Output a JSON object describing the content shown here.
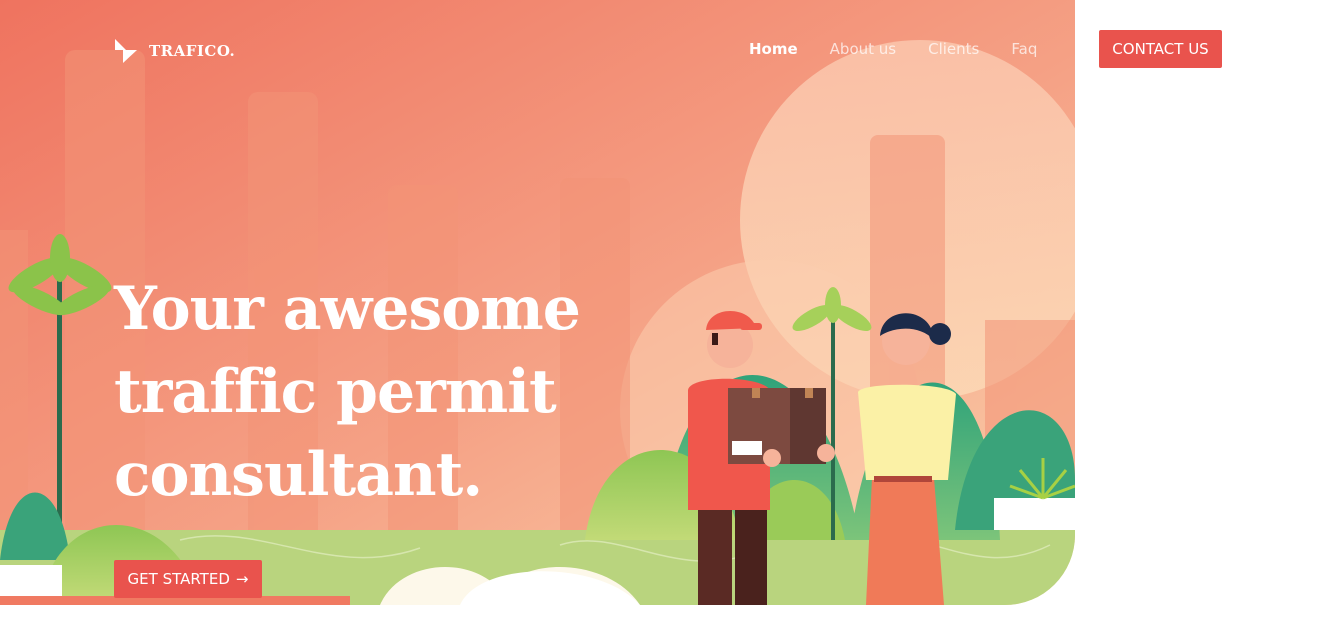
{
  "brand": {
    "name": "TRAFICO."
  },
  "nav": {
    "items": [
      {
        "label": "Home",
        "active": true
      },
      {
        "label": "About us"
      },
      {
        "label": "Clients"
      },
      {
        "label": "Faq"
      }
    ],
    "contact_label": "CONTACT US"
  },
  "hero": {
    "headline_lines": [
      "Your awesome",
      "traffic permit",
      "consultant."
    ],
    "cta_label": "GET STARTED",
    "cta_icon": "arrow-right-icon"
  },
  "colors": {
    "accent": "#e9534d",
    "hero_top": "#f07a62",
    "hero_bottom": "#f8c4a3",
    "grass": "#b7d27c"
  }
}
